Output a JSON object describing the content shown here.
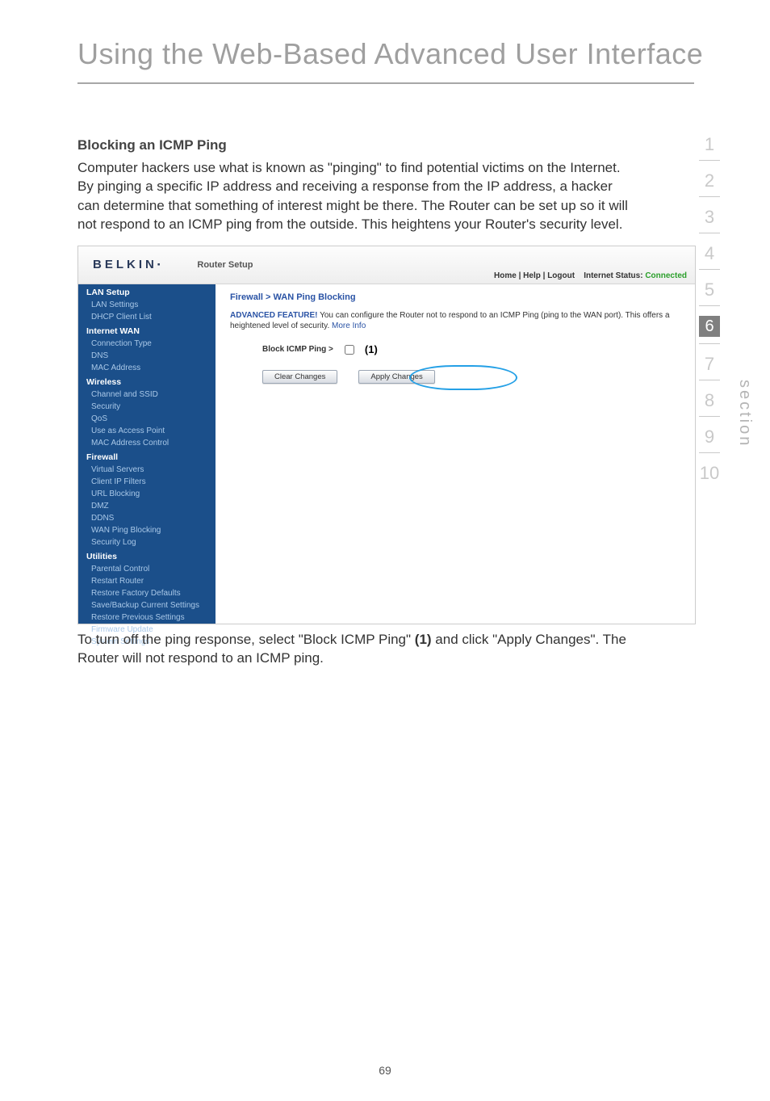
{
  "page": {
    "title": "Using the Web-Based Advanced User Interface",
    "number": "69",
    "section_label": "section"
  },
  "section_nav": {
    "numbers": [
      "1",
      "2",
      "3",
      "4",
      "5",
      "6",
      "7",
      "8",
      "9",
      "10"
    ],
    "current": "6"
  },
  "content": {
    "heading": "Blocking an ICMP Ping",
    "intro": "Computer hackers use what is known as \"pinging\" to find potential victims on the Internet. By pinging a specific IP address and receiving a response from the IP address, a hacker can determine that something of interest might be there. The Router can be set up so it will not respond to an ICMP ping from the outside. This heightens your Router's security level.",
    "instruction_pre": "To turn off the ping response, select \"Block ICMP Ping\" ",
    "instruction_bold": "(1)",
    "instruction_post": " and click \"Apply Changes\". The Router will not respond to an ICMP ping."
  },
  "screenshot": {
    "logo": "BELKIN",
    "router_setup": "Router Setup",
    "crumb_left": "Home | Help | Logout",
    "crumb_status_label": "Internet Status:",
    "crumb_status_value": "Connected",
    "sidebar_groups": [
      {
        "label": "LAN Setup",
        "items": [
          "LAN Settings",
          "DHCP Client List"
        ]
      },
      {
        "label": "Internet WAN",
        "items": [
          "Connection Type",
          "DNS",
          "MAC Address"
        ]
      },
      {
        "label": "Wireless",
        "items": [
          "Channel and SSID",
          "Security",
          "QoS",
          "Use as Access Point",
          "MAC Address Control"
        ]
      },
      {
        "label": "Firewall",
        "items": [
          "Virtual Servers",
          "Client IP Filters",
          "URL Blocking",
          "DMZ",
          "DDNS",
          "WAN Ping Blocking",
          "Security Log"
        ]
      },
      {
        "label": "Utilities",
        "items": [
          "Parental Control",
          "Restart Router",
          "Restore Factory Defaults",
          "Save/Backup Current Settings",
          "Restore Previous Settings",
          "Firmware Update",
          "System Settings"
        ]
      }
    ],
    "main": {
      "breadcrumb": "Firewall > WAN Ping Blocking",
      "adv_label": "ADVANCED FEATURE!",
      "adv_text": " You can configure the Router not to respond to an ICMP Ping (ping to the WAN port). This offers a heightened level of security. ",
      "more_info": "More Info",
      "block_label": "Block ICMP Ping >",
      "callout": "(1)",
      "clear_btn": "Clear Changes",
      "apply_btn": "Apply Changes"
    }
  }
}
